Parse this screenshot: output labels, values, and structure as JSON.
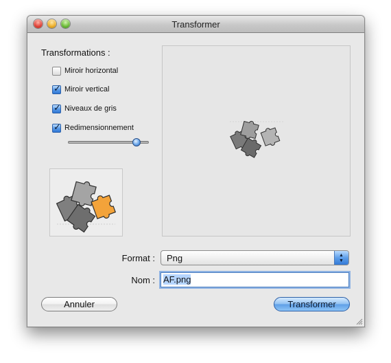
{
  "window": {
    "title": "Transformer"
  },
  "transforms": {
    "heading": "Transformations :",
    "options": [
      {
        "label": "Miroir horizontal",
        "checked": false
      },
      {
        "label": "Miroir vertical",
        "checked": true
      },
      {
        "label": "Niveaux de gris",
        "checked": true
      },
      {
        "label": "Redimensionnement",
        "checked": true
      }
    ],
    "resize_slider_value": 0.85
  },
  "format": {
    "label": "Format :",
    "selected": "Png"
  },
  "name": {
    "label": "Nom :",
    "value": "AF.png"
  },
  "buttons": {
    "cancel": "Annuler",
    "transform": "Transformer"
  },
  "colors": {
    "accent": "#5e9ee6",
    "puzzle_gray": "#8a8a8a",
    "puzzle_orange": "#f3a33a"
  }
}
